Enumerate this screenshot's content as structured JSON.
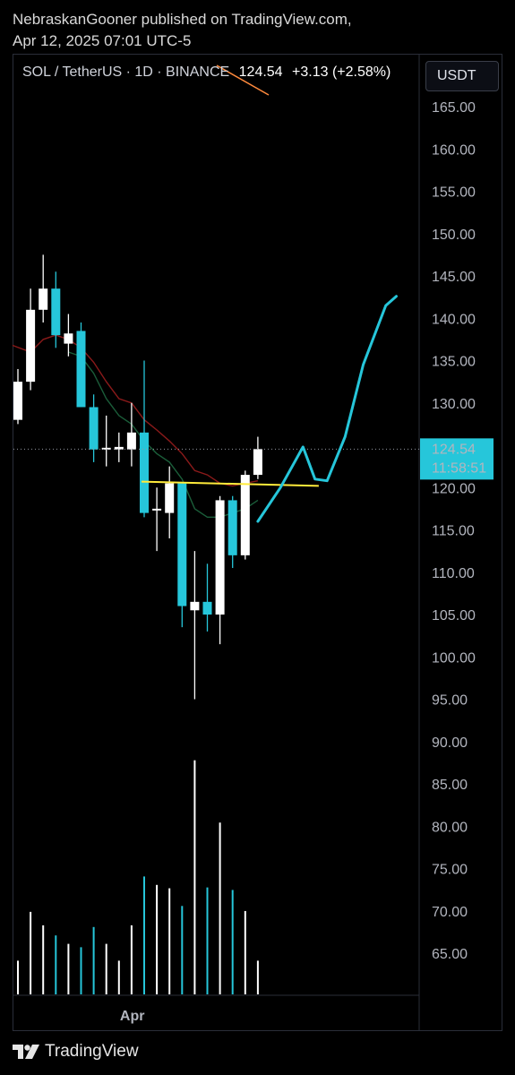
{
  "publish": {
    "line1": "NebraskanGooner published on TradingView.com,",
    "line2": "Apr 12, 2025 07:01 UTC-5"
  },
  "header": {
    "symbol": "SOL / TetherUS · 1D · BINANCE",
    "price": "124.54",
    "change": "+3.13 (+2.58%)"
  },
  "currency_button": "USDT",
  "brand": "TradingView",
  "colors": {
    "up_candle": "#ffffff",
    "down_candle": "#26c6da",
    "ma_fast": "#8b1a1a",
    "ma_slow": "#1b5e3a",
    "support_line": "#ffeb3b",
    "projection": "#26c6da",
    "ghost_line": "#ff8a3d"
  },
  "chart_data": {
    "type": "candlestick",
    "symbol": "SOL / TetherUS",
    "interval": "1D",
    "exchange": "BINANCE",
    "y_axis": {
      "ticks": [
        "165.00",
        "160.00",
        "155.00",
        "150.00",
        "145.00",
        "140.00",
        "135.00",
        "130.00",
        "125.00",
        "120.00",
        "115.00",
        "110.00",
        "105.00",
        "100.00",
        "95.00",
        "90.00",
        "85.00",
        "80.00",
        "75.00",
        "70.00",
        "65.00"
      ],
      "range": [
        60,
        170
      ]
    },
    "x_axis_label": "Apr",
    "last_price_label": {
      "price": "124.54",
      "countdown": "11:58:51"
    },
    "candles": [
      {
        "o": 128.0,
        "h": 134.0,
        "l": 127.5,
        "c": 132.5
      },
      {
        "o": 132.5,
        "h": 143.5,
        "l": 131.5,
        "c": 141.0
      },
      {
        "o": 141.0,
        "h": 147.5,
        "l": 139.5,
        "c": 143.5
      },
      {
        "o": 143.5,
        "h": 145.5,
        "l": 136.5,
        "c": 138.0
      },
      {
        "o": 137.0,
        "h": 140.5,
        "l": 135.5,
        "c": 138.2
      },
      {
        "o": 138.5,
        "h": 139.5,
        "l": 129.5,
        "c": 129.5
      },
      {
        "o": 129.5,
        "h": 131.0,
        "l": 123.0,
        "c": 124.5
      },
      {
        "o": 124.5,
        "h": 128.5,
        "l": 122.5,
        "c": 124.7
      },
      {
        "o": 124.5,
        "h": 126.5,
        "l": 123.0,
        "c": 124.8
      },
      {
        "o": 124.5,
        "h": 130.0,
        "l": 122.5,
        "c": 126.5
      },
      {
        "o": 126.5,
        "h": 135.0,
        "l": 116.5,
        "c": 117.0
      },
      {
        "o": 117.3,
        "h": 120.0,
        "l": 112.5,
        "c": 117.5
      },
      {
        "o": 117.0,
        "h": 122.5,
        "l": 114.0,
        "c": 120.5
      },
      {
        "o": 120.5,
        "h": 120.5,
        "l": 103.5,
        "c": 106.0
      },
      {
        "o": 105.5,
        "h": 112.5,
        "l": 95.0,
        "c": 106.5
      },
      {
        "o": 106.5,
        "h": 111.0,
        "l": 103.0,
        "c": 105.0
      },
      {
        "o": 105.0,
        "h": 119.0,
        "l": 101.5,
        "c": 118.5
      },
      {
        "o": 118.5,
        "h": 119.0,
        "l": 110.5,
        "c": 112.0
      },
      {
        "o": 112.0,
        "h": 122.0,
        "l": 111.5,
        "c": 121.5
      },
      {
        "o": 121.5,
        "h": 126.0,
        "l": 121.0,
        "c": 124.54
      }
    ],
    "volume_relative": [
      0.4,
      0.98,
      0.82,
      0.7,
      0.6,
      0.56,
      0.8,
      0.6,
      0.4,
      0.82,
      1.4,
      1.3,
      1.26,
      1.05,
      2.78,
      1.27,
      2.04,
      1.24,
      0.99,
      0.4
    ],
    "ma_fast": [
      136.8,
      136.0,
      137.5,
      138.0,
      137.5,
      136.5,
      134.8,
      132.5,
      130.5,
      130.0,
      128.0,
      126.8,
      125.5,
      124.0,
      122.0,
      121.5,
      120.5,
      120.2,
      120.5,
      120.8
    ],
    "ma_slow": [
      null,
      null,
      null,
      null,
      136.0,
      135.5,
      133.5,
      130.5,
      128.5,
      127.5,
      125.5,
      124.0,
      123.0,
      121.0,
      117.5,
      116.5,
      116.5,
      117.0,
      117.5,
      118.5
    ],
    "support_level": 120.3,
    "projection_path": [
      [
        0,
        116.0
      ],
      [
        1.5,
        120.0
      ],
      [
        3.0,
        124.8
      ],
      [
        3.8,
        121.0
      ],
      [
        4.6,
        120.8
      ],
      [
        5.8,
        126.0
      ],
      [
        7.0,
        134.5
      ],
      [
        8.5,
        141.5
      ],
      [
        9.2,
        142.6
      ]
    ]
  }
}
